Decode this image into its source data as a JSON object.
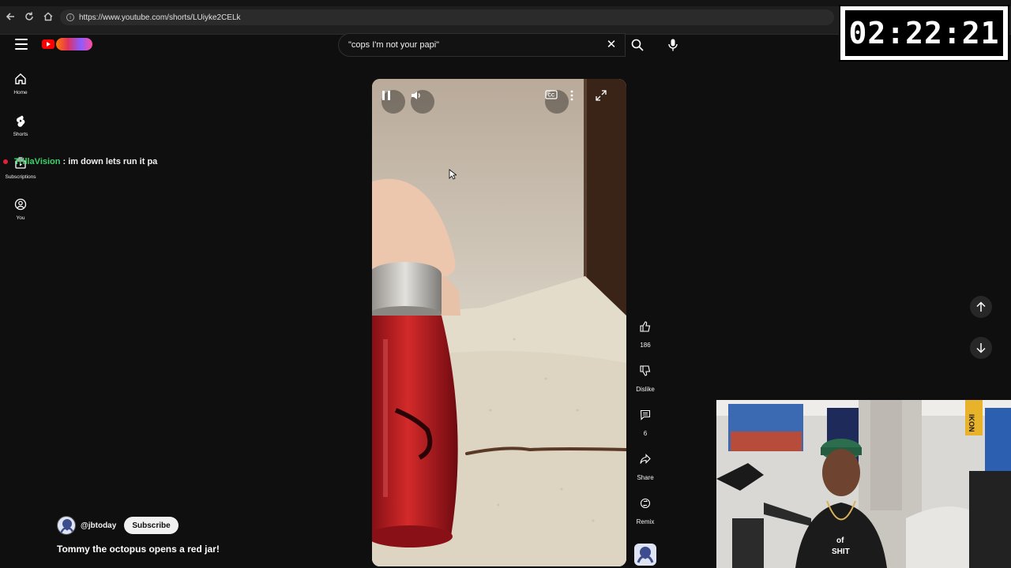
{
  "browser": {
    "url": "https://www.youtube.com/shorts/LUiyke2CELk",
    "icons": [
      "back-icon",
      "reload-icon",
      "home-icon",
      "site-info-icon"
    ]
  },
  "timer": {
    "text": "02:22:21"
  },
  "header": {
    "search_query": "\"cops I'm not your papi\"",
    "icons": [
      "menu-icon",
      "youtube-logo",
      "clear-icon",
      "search-icon",
      "mic-icon"
    ]
  },
  "sidebar": {
    "items": [
      {
        "label": "Home",
        "icon": "home-icon"
      },
      {
        "label": "Shorts",
        "icon": "shorts-icon"
      },
      {
        "label": "Subscriptions",
        "icon": "subscriptions-icon"
      },
      {
        "label": "You",
        "icon": "you-icon"
      }
    ]
  },
  "chat": {
    "name": "TrillaVision",
    "message": ": im down lets run it pa"
  },
  "player": {
    "controls": [
      "pause-icon",
      "volume-icon",
      "captions-icon",
      "more-icon",
      "fullscreen-icon"
    ]
  },
  "actions": {
    "like_count": "186",
    "dislike_label": "Dislike",
    "comment_count": "6",
    "share_label": "Share",
    "remix_label": "Remix"
  },
  "short": {
    "channel": "@jbtoday",
    "subscribe_label": "Subscribe",
    "title": "Tommy the octopus opens a red jar!"
  },
  "webcam": {
    "shirt_text_1": "of",
    "shirt_text_2": "SHIT",
    "banner_text": "IKON"
  },
  "colors": {
    "accent": "#ff0000",
    "chat_name": "#3ed26b",
    "background": "#0f0f0f"
  }
}
